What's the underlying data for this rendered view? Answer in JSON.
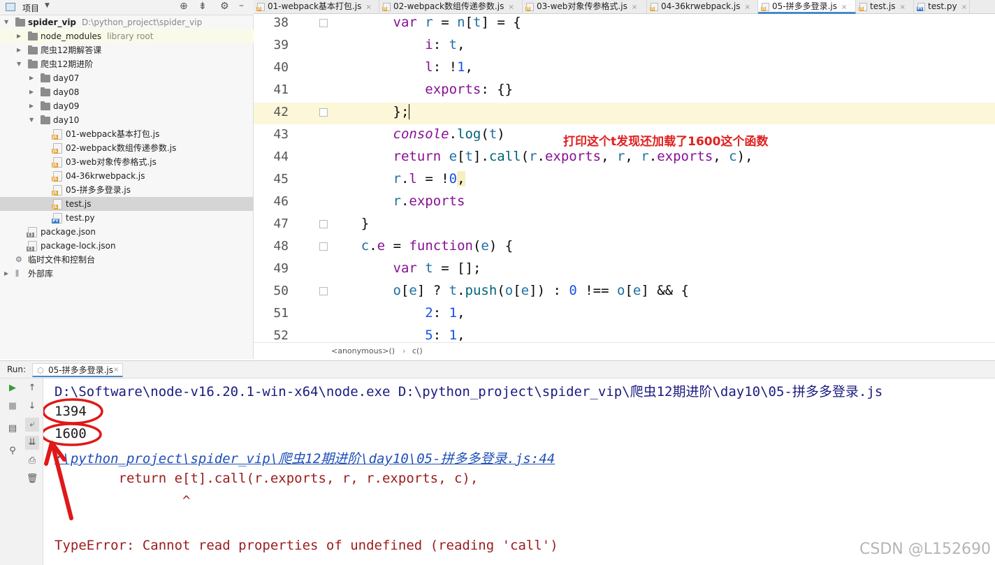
{
  "project_panel": {
    "title": "项目",
    "tree": [
      {
        "label": "spider_vip",
        "hint": "D:\\python_project\\spider_vip",
        "type": "folder",
        "expanded": true,
        "depth": 0
      },
      {
        "label": "node_modules",
        "hint": "library root",
        "type": "folder",
        "expanded": false,
        "depth": 1
      },
      {
        "label": "爬虫12期解答课",
        "hint": "",
        "type": "folder",
        "expanded": false,
        "depth": 1
      },
      {
        "label": "爬虫12期进阶",
        "hint": "",
        "type": "folder",
        "expanded": true,
        "depth": 1
      },
      {
        "label": "day07",
        "hint": "",
        "type": "folder",
        "expanded": false,
        "depth": 2
      },
      {
        "label": "day08",
        "hint": "",
        "type": "folder",
        "expanded": false,
        "depth": 2
      },
      {
        "label": "day09",
        "hint": "",
        "type": "folder",
        "expanded": false,
        "depth": 2
      },
      {
        "label": "day10",
        "hint": "",
        "type": "folder",
        "expanded": true,
        "depth": 2
      },
      {
        "label": "01-webpack基本打包.js",
        "hint": "",
        "type": "js",
        "depth": 3
      },
      {
        "label": "02-webpack数组传递参数.js",
        "hint": "",
        "type": "js",
        "depth": 3
      },
      {
        "label": "03-web对象传参格式.js",
        "hint": "",
        "type": "js",
        "depth": 3
      },
      {
        "label": "04-36krwebpack.js",
        "hint": "",
        "type": "js",
        "depth": 3
      },
      {
        "label": "05-拼多多登录.js",
        "hint": "",
        "type": "js",
        "depth": 3
      },
      {
        "label": "test.js",
        "hint": "",
        "type": "js",
        "depth": 3,
        "selected": true
      },
      {
        "label": "test.py",
        "hint": "",
        "type": "py",
        "depth": 3
      },
      {
        "label": "package.json",
        "hint": "",
        "type": "json",
        "depth": 1
      },
      {
        "label": "package-lock.json",
        "hint": "",
        "type": "json",
        "depth": 1
      },
      {
        "label": "临时文件和控制台",
        "hint": "",
        "type": "scratch",
        "depth": 0
      },
      {
        "label": "外部库",
        "hint": "",
        "type": "lib",
        "expanded": false,
        "depth": 0
      }
    ]
  },
  "tabs": [
    {
      "label": "01-webpack基本打包.js",
      "active": false
    },
    {
      "label": "02-webpack数组传递参数.js",
      "active": false
    },
    {
      "label": "03-web对象传参格式.js",
      "active": false
    },
    {
      "label": "04-36krwebpack.js",
      "active": false
    },
    {
      "label": "05-拼多多登录.js",
      "active": true
    },
    {
      "label": "test.js",
      "active": false
    },
    {
      "label": "test.py",
      "active": false
    }
  ],
  "editor": {
    "line_numbers": [
      "38",
      "39",
      "40",
      "41",
      "42",
      "43",
      "44",
      "45",
      "46",
      "47",
      "48",
      "49",
      "50",
      "51",
      "52"
    ],
    "current_line": "42",
    "annotation": "打印这个t发现还加载了1600这个函数",
    "breadcrumb": [
      "<anonymous>()",
      "c()"
    ]
  },
  "run": {
    "label": "Run:",
    "tab": "05-拼多多登录.js",
    "console_lines": [
      "D:\\Software\\node-v16.20.1-win-x64\\node.exe D:\\python_project\\spider_vip\\爬虫12期进阶\\day10\\05-拼多多登录.js",
      "1394",
      "1600",
      ":\\python_project\\spider_vip\\爬虫12期进阶\\day10\\05-拼多多登录.js:44",
      "        return e[t].call(r.exports, r, r.exports, c),",
      "                ^",
      "",
      "TypeError: Cannot read properties of undefined (reading 'call')"
    ]
  },
  "watermark": "CSDN @L152690",
  "colors": {
    "annotation": "#e02020",
    "current_line_bg": "#fcf7d8",
    "tab_active": "#4a88c7"
  }
}
